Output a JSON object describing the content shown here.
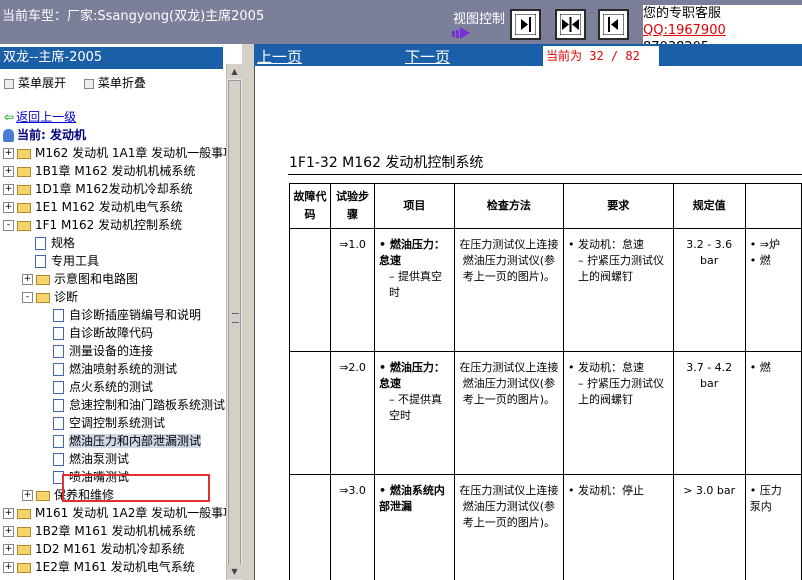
{
  "header": {
    "car_model": "当前车型：厂家:Ssangyong(双龙)主席2005",
    "view_control_label": "视图控制",
    "view_buttons": [
      "collapse-left-icon",
      "split-view-icon",
      "collapse-right-icon"
    ],
    "service_label": "您的专职客服",
    "service_qq_prefix": "QQ:1967900",
    "service_qq_line2": "87038205"
  },
  "tree": {
    "title": "双龙--主席-2005",
    "expand_all": "菜单展开",
    "collapse_all": "菜单折叠",
    "back_up": "返回上一级",
    "current": "当前: 发动机",
    "items": [
      {
        "label": "M162 发动机 1A1章 发动机一般事项",
        "level": 0,
        "kind": "folder",
        "expander": "+"
      },
      {
        "label": "1B1章 M162 发动机机械系统",
        "level": 0,
        "kind": "folder",
        "expander": "+"
      },
      {
        "label": "1D1章 M162发动机冷却系统",
        "level": 0,
        "kind": "folder",
        "expander": "+"
      },
      {
        "label": "1E1 M162 发动机电气系统",
        "level": 0,
        "kind": "folder",
        "expander": "+"
      },
      {
        "label": "1F1 M162 发动机控制系统",
        "level": 0,
        "kind": "folder",
        "expander": "-"
      },
      {
        "label": "规格",
        "level": 1,
        "kind": "doc"
      },
      {
        "label": "专用工具",
        "level": 1,
        "kind": "doc"
      },
      {
        "label": "示意图和电路图",
        "level": 1,
        "kind": "folder",
        "expander": "+"
      },
      {
        "label": "诊断",
        "level": 1,
        "kind": "folder",
        "expander": "-"
      },
      {
        "label": "自诊断插座销编号和说明",
        "level": 2,
        "kind": "doc"
      },
      {
        "label": "自诊断故障代码",
        "level": 2,
        "kind": "doc"
      },
      {
        "label": "测量设备的连接",
        "level": 2,
        "kind": "doc"
      },
      {
        "label": "燃油喷射系统的测试",
        "level": 2,
        "kind": "doc"
      },
      {
        "label": "点火系统的测试",
        "level": 2,
        "kind": "doc"
      },
      {
        "label": "怠速控制和油门踏板系统测试",
        "level": 2,
        "kind": "doc"
      },
      {
        "label": "空调控制系统测试",
        "level": 2,
        "kind": "doc"
      },
      {
        "label": "燃油压力和内部泄漏测试",
        "level": 2,
        "kind": "doc",
        "selected": true
      },
      {
        "label": "燃油泵测试",
        "level": 2,
        "kind": "doc"
      },
      {
        "label": "喷油嘴测试",
        "level": 2,
        "kind": "doc"
      },
      {
        "label": "保养和维修",
        "level": 1,
        "kind": "folder",
        "expander": "+"
      },
      {
        "label": "M161 发动机 1A2章 发动机一般事项",
        "level": 0,
        "kind": "folder",
        "expander": "+"
      },
      {
        "label": "1B2章 M161 发动机机械系统",
        "level": 0,
        "kind": "folder",
        "expander": "+"
      },
      {
        "label": "1D2 M161 发动机冷却系统",
        "level": 0,
        "kind": "folder",
        "expander": "+"
      },
      {
        "label": "1E2章 M161 发动机电气系统",
        "level": 0,
        "kind": "folder",
        "expander": "+"
      }
    ]
  },
  "nav": {
    "prev": "上一页",
    "next": "下一页",
    "page_info": "当前为 32 / 82"
  },
  "document": {
    "section_title": "1F1-32  M162 发动机控制系统",
    "headers": [
      "故障代码",
      "试验步骤",
      "项目",
      "检查方法",
      "要求",
      "规定值",
      ""
    ],
    "rows": [
      {
        "step": "⇒1.0",
        "item_main": "燃油压力：怠速",
        "item_sub": "– 提供真空时",
        "method": "在压力测试仪上连接燃油压力测试仪(参考上一页的图片)。",
        "req_main": "• 发动机：怠速",
        "req_sub": "– 拧紧压力测试仪上的阀螺钉",
        "spec": "3.2 - 3.6 bar",
        "extra": "• ⇒炉\n• 燃"
      },
      {
        "step": "⇒2.0",
        "item_main": "燃油压力：怠速",
        "item_sub": "– 不提供真空时",
        "method": "在压力测试仪上连接燃油压力测试仪(参考上一页的图片)。",
        "req_main": "• 发动机：怠速",
        "req_sub": "– 拧紧压力测试仪上的阀螺钉",
        "spec": "3.7 - 4.2 bar",
        "extra": "• 燃"
      },
      {
        "step": "⇒3.0",
        "item_main": "燃油系统内部泄漏",
        "item_sub": "",
        "method": "在压力测试仪上连接燃油压力测试仪(参考上一页的图片)。",
        "req_main": "• 发动机：停止",
        "req_sub": "",
        "spec": "> 3.0 bar",
        "extra": "• 压力\n泵内"
      }
    ]
  }
}
